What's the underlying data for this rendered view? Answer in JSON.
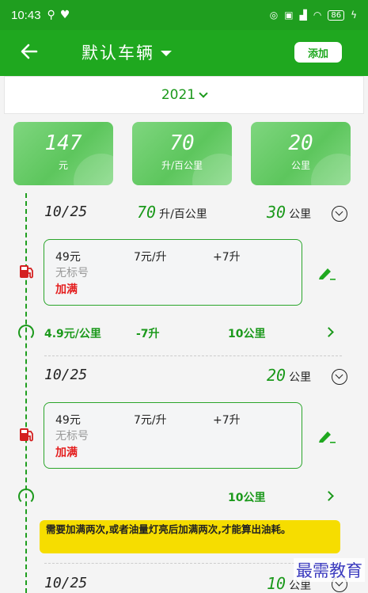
{
  "status_bar": {
    "time": "10:43",
    "battery": "86"
  },
  "app_bar": {
    "title": "默认车辆",
    "add_button": "添加"
  },
  "year_selector": {
    "value": "2021"
  },
  "stats": [
    {
      "value": "147",
      "unit": "元"
    },
    {
      "value": "70",
      "unit": "升/百公里"
    },
    {
      "value": "20",
      "unit": "公里"
    }
  ],
  "entries": [
    {
      "date": "10/25",
      "consumption": "70",
      "consumption_unit": "升/百公里",
      "distance": "30",
      "distance_unit": "公里",
      "card": {
        "amount": "49元",
        "price": "7元/升",
        "volume": "+7升",
        "grade": "无标号",
        "fill": "加满"
      },
      "summary": {
        "cost_per_km": "4.9元/公里",
        "liters": "-7升",
        "km": "10公里"
      }
    },
    {
      "date": "10/25",
      "distance": "20",
      "distance_unit": "公里",
      "card": {
        "amount": "49元",
        "price": "7元/升",
        "volume": "+7升",
        "grade": "无标号",
        "fill": "加满"
      },
      "summary": {
        "km": "10公里"
      }
    },
    {
      "date": "10/25",
      "distance": "10",
      "distance_unit": "公里"
    }
  ],
  "warning": "需要加满两次,或者油量灯亮后加满两次,才能算出油耗。",
  "watermark": "最需教育",
  "colors": {
    "primary": "#1fa81f",
    "accent_green": "#1b991b",
    "warning_bg": "#f6dd00",
    "fill_red": "#e41e1e"
  }
}
